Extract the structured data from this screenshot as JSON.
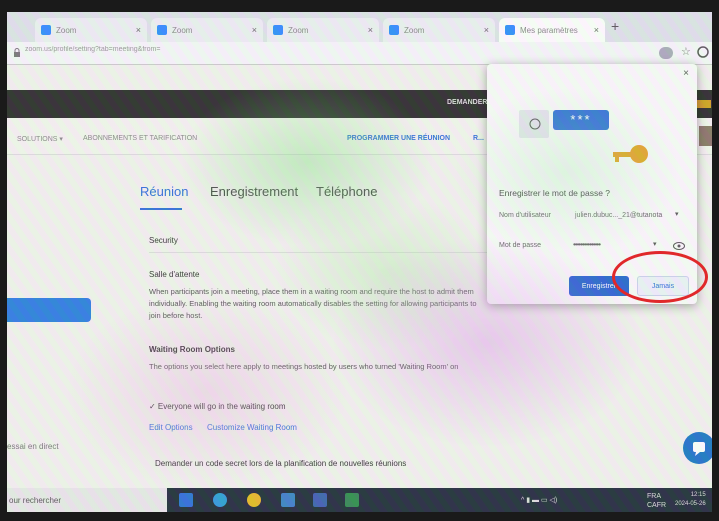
{
  "browser": {
    "tabs": [
      {
        "label": "Zoom"
      },
      {
        "label": "Zoom"
      },
      {
        "label": "Zoom"
      },
      {
        "label": "Zoom"
      },
      {
        "label": "Mes paramètres"
      }
    ],
    "new_tab": "+",
    "close_glyph": "×",
    "url": "zoom.us/profile/setting?tab=meeting&from=",
    "icons": [
      "lock-icon",
      "key-icon",
      "star-icon",
      "profile-icon"
    ]
  },
  "zoom": {
    "dark_nav_item": "DEMANDER",
    "subnav": {
      "solutions": "SOLUTIONS ▾",
      "plans": "ABONNEMENTS ET TARIFICATION",
      "schedule": "PROGRAMMER UNE RÉUNION",
      "join": "R..."
    },
    "left_bottom_text": "essai en direct",
    "settings_tabs": [
      "Réunion",
      "Enregistrement",
      "Téléphone"
    ],
    "security_heading": "Security",
    "waiting_room_title": "Salle d'attente",
    "waiting_room_desc": "When participants join a meeting, place them in a waiting room and require the host to admit them individually. Enabling the waiting room automatically disables the setting for allowing participants to join before host.",
    "options_title": "Waiting Room Options",
    "options_desc": "The options you select here apply to meetings hosted by users who turned 'Waiting Room' on",
    "option_item": "✓ Everyone will go in the waiting room",
    "edit_options": "Edit Options",
    "customize": "Customize Waiting Room",
    "passcode_row": "Demander un code secret lors de la planification de nouvelles réunions"
  },
  "password_popup": {
    "title": "Enregistrer le mot de passe ?",
    "card_text": "***",
    "username_label": "Nom d'utilisateur",
    "username_value": "julien.dubuc..._21@tutanota",
    "username_caret": "▾",
    "password_label": "Mot de passe",
    "password_value": "•••••••••••••••",
    "password_caret": "▾",
    "save_button": "Enregistrer",
    "never_button": "Jamais",
    "close": "×"
  },
  "taskbar": {
    "search_text": "our rechercher",
    "tray_glyphs": "^   ▮   ▬   ▭   ◁)",
    "language": "FRA",
    "layout": "CAFR",
    "time": "12:15",
    "date": "2024-05-26"
  },
  "colors": {
    "accent": "#2d6fd8",
    "annotation": "#e0282a",
    "dark_nav": "#2a2a2a"
  }
}
